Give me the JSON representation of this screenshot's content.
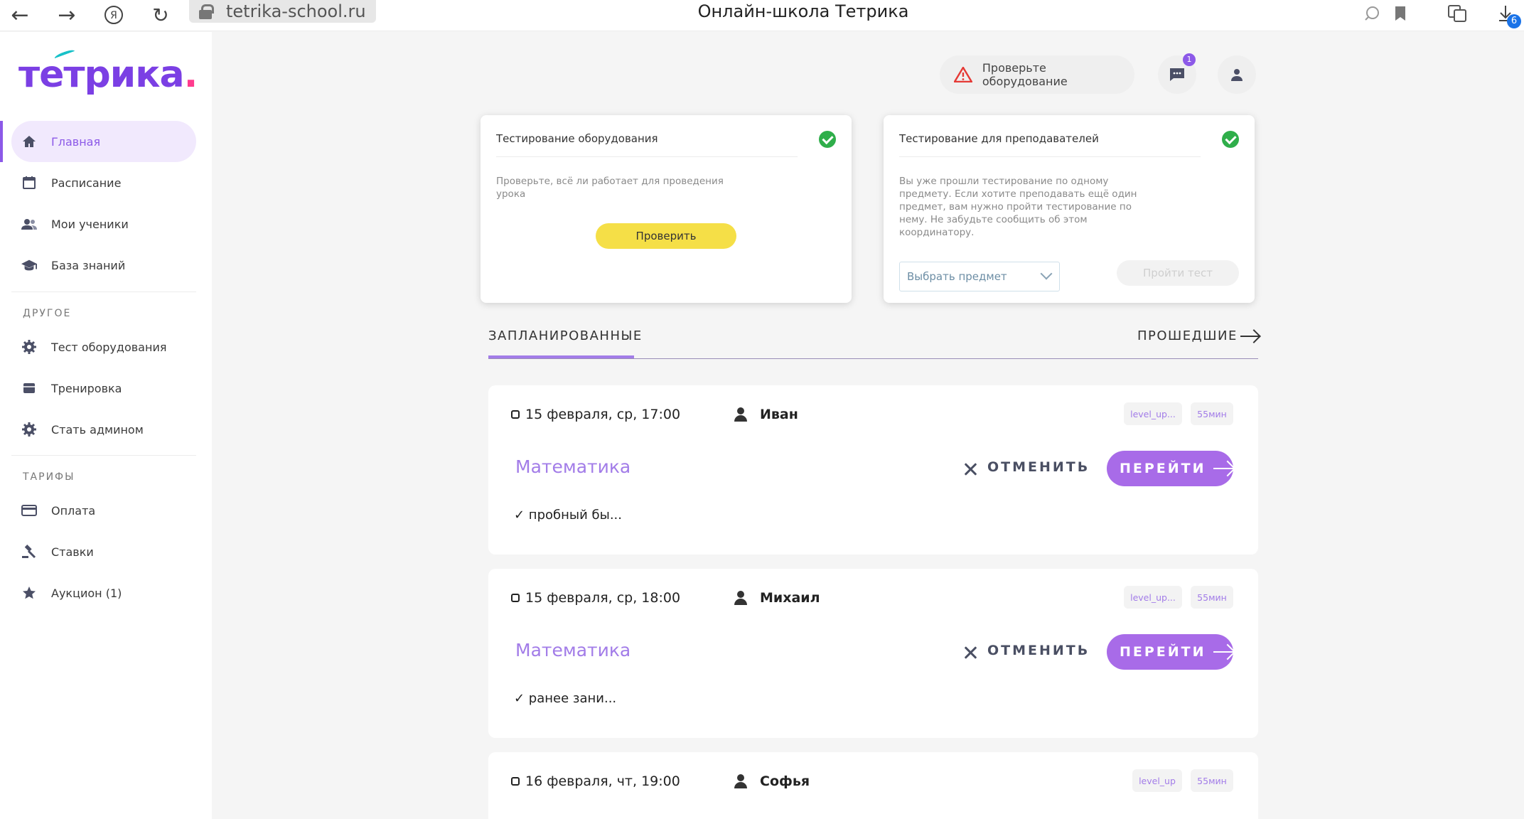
{
  "browser": {
    "url": "tetrika-school.ru",
    "title": "Онлайн-школа Тетрика",
    "downloads_count": "6"
  },
  "sidebar": {
    "logo_main": "тетрика",
    "logo_dot": ".",
    "items": [
      {
        "label": "Главная"
      },
      {
        "label": "Расписание"
      },
      {
        "label": "Мои ученики"
      },
      {
        "label": "База знаний"
      }
    ],
    "section_other": "ДРУГОЕ",
    "other_items": [
      {
        "label": "Тест оборудования"
      },
      {
        "label": "Тренировка"
      },
      {
        "label": "Стать админом"
      }
    ],
    "section_tariffs": "ТАРИФЫ",
    "tariff_items": [
      {
        "label": "Оплата"
      },
      {
        "label": "Ставки"
      },
      {
        "label": "Аукцион (1)"
      }
    ]
  },
  "header": {
    "check_equipment": "Проверьте оборудование",
    "notifications_count": "1"
  },
  "cards": {
    "equipment": {
      "title": "Тестирование оборудования",
      "text": "Проверьте, всё ли работает для проведения урока",
      "button": "Проверить"
    },
    "teachers": {
      "title": "Тестирование для преподавателей",
      "text": "Вы уже прошли тестирование по одному предмету. Если хотите преподавать ещё один предмет, вам нужно пройти тестирование по нему. Не забудьте сообщить об этом координатору.",
      "select_placeholder": "Выбрать предмет",
      "button": "Пройти тест"
    }
  },
  "tabs": {
    "planned": "ЗАПЛАНИРОВАННЫЕ",
    "past": "ПРОШЕДШИЕ"
  },
  "lessons": [
    {
      "date": "15 февраля, ср, 17:00",
      "student": "Иван",
      "tag1": "level_up...",
      "tag2": "55мин",
      "subject": "Математика",
      "cancel": "ОТМЕНИТЬ",
      "go": "ПЕРЕЙТИ",
      "note": "✓ пробный бы..."
    },
    {
      "date": "15 февраля, ср, 18:00",
      "student": "Михаил",
      "tag1": "level_up...",
      "tag2": "55мин",
      "subject": "Математика",
      "cancel": "ОТМЕНИТЬ",
      "go": "ПЕРЕЙТИ",
      "note": "✓ ранее зани..."
    },
    {
      "date": "16 февраля, чт, 19:00",
      "student": "Софья",
      "tag1": "level_up",
      "tag2": "55мин"
    }
  ]
}
